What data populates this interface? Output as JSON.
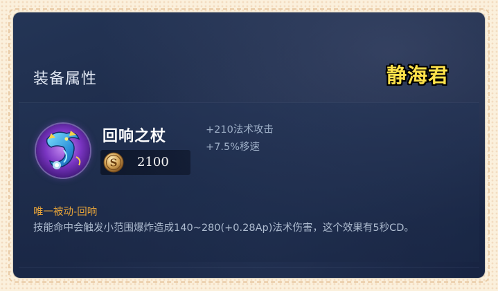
{
  "section": {
    "title": "装备属性"
  },
  "watermark": "静海君",
  "item": {
    "name": "回响之杖",
    "icon": "purple-dragon-staff-icon",
    "price": "2100",
    "currency_icon": "gold-coin-icon",
    "stats": [
      "+210法术攻击",
      "+7.5%移速"
    ],
    "passive": {
      "title": "唯一被动-回响",
      "description": "技能命中会触发小范围爆炸造成140~280(+0.28Ap)法术伤害，这个效果有5秒CD。"
    }
  },
  "colors": {
    "panel_background": "#1c2a48",
    "passive_title": "#e3a23a",
    "watermark": "#ffe24a",
    "frame": "#fbf0dc"
  }
}
